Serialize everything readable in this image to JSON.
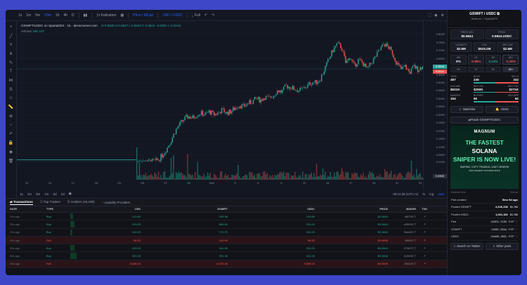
{
  "toolbar": {
    "intervals": [
      "1s",
      "1m",
      "5m",
      "15m",
      "1h",
      "4h",
      "D"
    ],
    "indicators": "Indicators",
    "price_mcap": "Price / MCap",
    "usd_usdc": "USD / USDC",
    "full": "Full"
  },
  "legend": {
    "title": "GSWIFT/USDC on SpartaDEX · 15 · dexscreener.com",
    "ohlc": "O 0.5845  H 0.5847  L 0.5843  C 0.5844  −0.0001 (−0.01%)",
    "volume": "Volume",
    "volume_val": "15K  107"
  },
  "chart_data": {
    "type": "candlestick",
    "y_ticks": [
      "0.8000",
      "0.7500",
      "0.7000",
      "0.6500",
      "0.6000",
      "0.5500",
      "0.5000",
      "0.4500",
      "0.4000",
      "0.3500",
      "0.3000",
      "0.2500",
      "0.2000",
      "0.1500",
      "0.1000",
      "0.0500",
      "0.0100"
    ],
    "ylim": [
      0.01,
      0.82
    ],
    "x_ticks": [
      "11",
      "14",
      "17",
      "20",
      "23",
      "25",
      "27",
      "29",
      "Dec",
      "3",
      "5",
      "9",
      "12",
      "14",
      "17",
      "19",
      "21",
      "23"
    ],
    "current_price": "0.5844",
    "current_price_tag_2": "0.5841",
    "last_volume_tag": "0.0300",
    "price_path": [
      0.005,
      0.006,
      0.007,
      0.008,
      0.01,
      0.02,
      0.05,
      0.09,
      0.14,
      0.2,
      0.24,
      0.27,
      0.29,
      0.28,
      0.3,
      0.31,
      0.3,
      0.32,
      0.3,
      0.31,
      0.33,
      0.31,
      0.32,
      0.34,
      0.36,
      0.35,
      0.37,
      0.38,
      0.4,
      0.39,
      0.41,
      0.4,
      0.42,
      0.45,
      0.44,
      0.48,
      0.47,
      0.46,
      0.45,
      0.46,
      0.48,
      0.5,
      0.5,
      0.52,
      0.58,
      0.64,
      0.7,
      0.74,
      0.72,
      0.62,
      0.66,
      0.6,
      0.64,
      0.62,
      0.58,
      0.62,
      0.66,
      0.7,
      0.74,
      0.72,
      0.68,
      0.62,
      0.58,
      0.6,
      0.56,
      0.6,
      0.58,
      0.6,
      0.58
    ]
  },
  "bottom_bar": {
    "ranges": [
      "1y",
      "1m",
      "3m",
      "1m",
      "5d",
      "1d"
    ],
    "time": "09:11:36 (UTC+1)",
    "pct": "%",
    "log": "log",
    "auto": "auto"
  },
  "tabs": {
    "transactions": "Transactions",
    "top_traders": "Top Traders",
    "holders": "Holders (15,430)",
    "liquidity": "Liquidity Providers"
  },
  "table": {
    "headers": {
      "date": "DATE",
      "type": "TYPE",
      "usd": "USD",
      "gswift": "GSWIFT",
      "usdc": "USDC",
      "price": "PRICE",
      "maker": "MAKER",
      "txn": "TXN"
    },
    "rows": [
      {
        "date": "20s ago",
        "type": "Buy",
        "usd": "143.89",
        "gswift": "245.48",
        "usdc": "143.89",
        "price": "$0.5844",
        "maker": "4827f8",
        "bar": 0.05
      },
      {
        "date": "20s ago",
        "type": "Buy",
        "usd": "203.00",
        "gswift": "885.00",
        "usdc": "203.00",
        "price": "$0.5844",
        "maker": "c09926",
        "bar": 0.08
      },
      {
        "date": "31s ago",
        "type": "Buy",
        "usd": "100.00",
        "gswift": "170.70",
        "usdc": "100.00",
        "price": "$0.5840",
        "maker": "3bee63",
        "bar": 0.04
      },
      {
        "date": "42s ago",
        "type": "Sell",
        "usd": "58.32",
        "gswift": "100.00",
        "usdc": "58.32",
        "price": "$0.5836",
        "maker": "6f2f20",
        "bar": 0.0
      },
      {
        "date": "50s ago",
        "type": "Buy",
        "usd": "200.00",
        "gswift": "344.89",
        "usdc": "200.00",
        "price": "$0.5844",
        "maker": "373672",
        "bar": 0.08
      },
      {
        "date": "52s ago",
        "type": "Buy",
        "usd": "322.00",
        "gswift": "551.35",
        "usdc": "322.00",
        "price": "$0.5838",
        "maker": "415908",
        "bar": 0.13
      },
      {
        "date": "53s ago",
        "type": "Sell",
        "usd": "3,638.18",
        "gswift": "6,235.45",
        "usdc": "3,638.18",
        "price": "$0.5835",
        "maker": "6f4318",
        "bar": 0.0
      }
    ]
  },
  "side": {
    "pair": "GSWIFT / USDC",
    "chain": "Arbitrum  >  SpartaDEX",
    "price_usd_lbl": "PRICE USD",
    "price_usd": "$0.5844",
    "price_lbl": "PRICE",
    "price": "0.5844 USDC",
    "liq_lbl": "LIQUIDITY",
    "liq": "$2.6M",
    "fdv_lbl": "FDV",
    "fdv": "$515.2M",
    "mcap_lbl": "MKT CAP",
    "mcap": "$2.6M",
    "changes": [
      {
        "lbl": "5M",
        "val": "0%",
        "cls": ""
      },
      {
        "lbl": "1H",
        "val": "-0.88%",
        "cls": "neg"
      },
      {
        "lbl": "6H",
        "val": "4.14%",
        "cls": "pos"
      },
      {
        "lbl": "24H",
        "val": "-2.28%",
        "cls": "neg"
      }
    ],
    "timeframes": [
      "5M",
      "1H",
      "6H",
      "24H"
    ],
    "txns_lbl": "TXNS",
    "txns": "487",
    "buys_lbl": "BUYS",
    "buys": "245",
    "sells_lbl": "SELLS",
    "sells": "242",
    "volume_lbl": "VOLUME",
    "volume": "$521K",
    "buyvol_lbl": "BUY VOL",
    "buyvol": "$250K",
    "sellvol_lbl": "SELL VOL",
    "sellvol": "$271K",
    "makers_lbl": "MAKERS",
    "makers": "154",
    "buyers_lbl": "BUYERS",
    "buyers": "90",
    "sellers_lbl": "SELLERS",
    "sellers": "92",
    "buy_ratio": 0.5,
    "watchlist": "Watchlist",
    "alerts": "Alerts",
    "trade": "Trade GSWIFT/USDC",
    "ad": {
      "logo": "MAGNUM",
      "l1": "THE FASTEST",
      "l2": "SOLANA",
      "l3": "SNIPER IS NOW LIVE!",
      "l4": "SNIPING, COPY TRADING, LIMIT ORDERS",
      "l5": "AND HIGHEST SUCCESS RATE"
    },
    "advertise": "Advertise here",
    "hide_ad": "Hide ad",
    "pair_created_k": "Pair created",
    "pair_created_v": "5mo 5d ago",
    "pooled_gswift_k": "Pooled GSWIFT",
    "pooled_gswift_v": "2,226,236",
    "pooled_gswift_u": "$1.3M",
    "pooled_usdc_k": "Pooled USDC",
    "pooled_usdc_v": "1,301,181",
    "pooled_usdc_u": "$1.3M",
    "pair_k": "Pair",
    "pair_addr": "0x5F8...7C56",
    "gswift_k": "GSWIFT",
    "gswift_addr": "0x580...2B4a",
    "usdc_k": "USDC",
    "usdc_addr": "0xaf88...5831",
    "exp": "EXP",
    "search_twitter": "Search on Twitter",
    "other_pairs": "Other pairs"
  }
}
